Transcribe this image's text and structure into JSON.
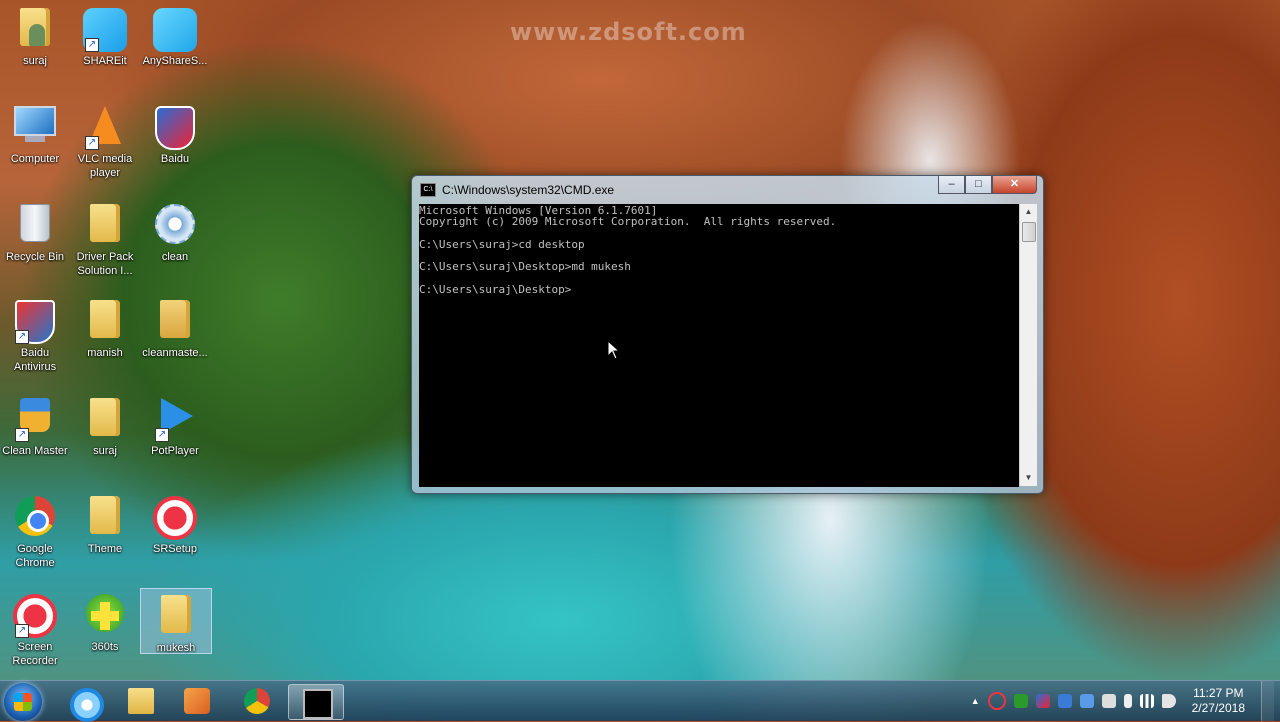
{
  "watermark": "www.zdsoft.com",
  "desktop_icons": [
    {
      "id": "suraj-user",
      "label": "suraj"
    },
    {
      "id": "shareit",
      "label": "SHAREit"
    },
    {
      "id": "anyshare",
      "label": "AnyShareS..."
    },
    {
      "id": "computer",
      "label": "Computer"
    },
    {
      "id": "vlc",
      "label": "VLC media player"
    },
    {
      "id": "baidu",
      "label": "Baidu"
    },
    {
      "id": "recycle",
      "label": "Recycle Bin"
    },
    {
      "id": "driverpack",
      "label": "Driver Pack Solution I..."
    },
    {
      "id": "clean",
      "label": "clean"
    },
    {
      "id": "baidu-av",
      "label": "Baidu Antivirus"
    },
    {
      "id": "manish",
      "label": "manish"
    },
    {
      "id": "cleanmaster-folder",
      "label": "cleanmaste..."
    },
    {
      "id": "clean-master",
      "label": "Clean Master"
    },
    {
      "id": "suraj-folder",
      "label": "suraj"
    },
    {
      "id": "potplayer",
      "label": "PotPlayer"
    },
    {
      "id": "chrome",
      "label": "Google Chrome"
    },
    {
      "id": "theme",
      "label": "Theme"
    },
    {
      "id": "srsetup",
      "label": "SRSetup"
    },
    {
      "id": "screen-recorder",
      "label": "Screen Recorder"
    },
    {
      "id": "360ts",
      "label": "360ts"
    },
    {
      "id": "mukesh",
      "label": "mukesh"
    }
  ],
  "cmd": {
    "title": "C:\\Windows\\system32\\CMD.exe",
    "console_text": "Microsoft Windows [Version 6.1.7601]\nCopyright (c) 2009 Microsoft Corporation.  All rights reserved.\n\nC:\\Users\\suraj>cd desktop\n\nC:\\Users\\suraj\\Desktop>md mukesh\n\nC:\\Users\\suraj\\Desktop>",
    "min_glyph": "–",
    "max_glyph": "□",
    "close_glyph": "✕"
  },
  "taskbar": {
    "items": [
      "start",
      "internet-explorer",
      "file-explorer",
      "media-player",
      "google-chrome",
      "command-prompt"
    ],
    "active": "command-prompt",
    "tray_arrow": "▲",
    "time": "11:27 PM",
    "date": "2/27/2018"
  }
}
